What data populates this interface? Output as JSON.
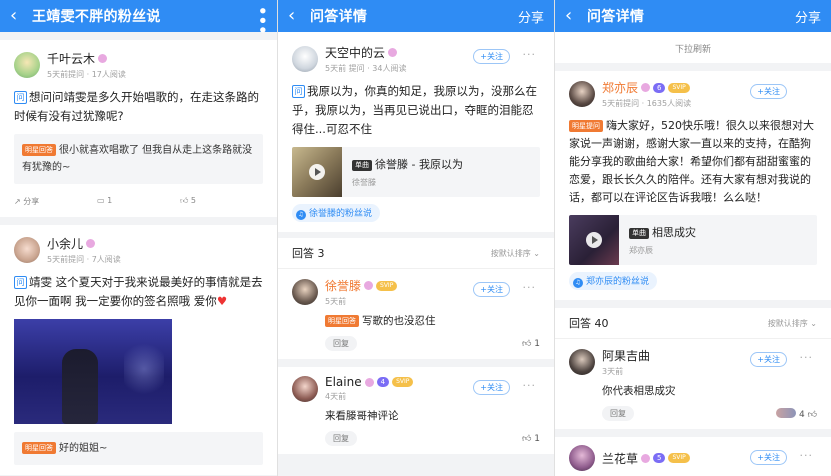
{
  "screen1": {
    "title": "王靖雯不胖的粉丝说",
    "posts": [
      {
        "user": "千叶云木",
        "meta": "5天前提问 · 17人阅读",
        "question": "想问问靖雯是多久开始唱歌的，在走这条路的时候有没有过犹豫呢?",
        "answer_tag": "明星回答",
        "answer": "很小就喜欢唱歌了 但我自从走上这条路就没有犹豫的~",
        "actions": [
          "分享",
          "1",
          "5"
        ]
      },
      {
        "user": "小余儿",
        "meta": "5天前提问 · 7人阅读",
        "question": "靖雯 这个夏天对于我来说最美好的事情就是去见你一面啊  我一定要你的签名照哦 爱你",
        "heart": "♥",
        "answer_tag": "明星回答",
        "answer": "好的姐姐~"
      }
    ]
  },
  "screen2": {
    "title": "问答详情",
    "share": "分享",
    "asker": {
      "user": "天空中的云",
      "meta": "5天前 提问 · 34人阅读",
      "follow": "+关注",
      "question": "我原以为，你真的知足，我原以为，没那么在乎，我原以为，当再见已说出口，夺眶的泪能忍得住...可忍不住",
      "song_tag": "单曲",
      "song": "徐誉滕 - 我原以为",
      "artist": "徐誉滕",
      "fan_link": "徐誉滕的粉丝说"
    },
    "answers_label": "回答 3",
    "sort_label": "按默认排序",
    "replies": [
      {
        "user": "徐誉滕",
        "svip": "SVIP",
        "meta": "5天前",
        "follow": "+关注",
        "tag": "明星回答",
        "text": "写歌的也没忍住",
        "reply_btn": "回复",
        "likes": "1"
      },
      {
        "user": "Elaine",
        "level": "4",
        "svip": "SVIP",
        "meta": "4天前",
        "follow": "+关注",
        "text": "来看滕哥神评论",
        "reply_btn": "回复",
        "likes": "1"
      }
    ]
  },
  "screen3": {
    "title": "问答详情",
    "share": "分享",
    "refresh": "下拉刷新",
    "asker": {
      "user": "郑亦辰",
      "level": "6",
      "svip": "SVIP",
      "meta": "5天前提问 · 1635人阅读",
      "follow": "+关注",
      "tag": "明星提问",
      "question": "嗨大家好，520快乐哦！很久以来很想对大家说一声谢谢，感谢大家一直以来的支持，在酷狗能分享我的歌曲给大家！希望你们都有甜甜蜜蜜的恋爱，跟长长久久的陪伴。还有大家有想对我说的话，都可以在评论区告诉我哦！么么哒！",
      "song_tag": "单曲",
      "song": "相思成灾",
      "artist": "郑亦辰",
      "fan_link": "郑亦辰的粉丝说"
    },
    "answers_label": "回答 40",
    "sort_label": "按默认排序",
    "replies": [
      {
        "user": "阿果吉曲",
        "meta": "3天前",
        "follow": "+关注",
        "text": "你代表相思成灾",
        "reply_btn": "回复",
        "likes": "4"
      },
      {
        "user": "兰花草",
        "level": "5",
        "svip": "SVIP",
        "follow": "+关注"
      }
    ]
  }
}
